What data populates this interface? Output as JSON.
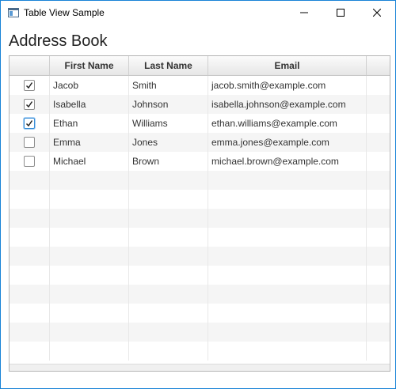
{
  "window": {
    "title": "Table View Sample",
    "icon": "app-window-icon",
    "controls": [
      "minimize-icon",
      "maximize-icon",
      "close-icon"
    ]
  },
  "heading": "Address Book",
  "table": {
    "columns": [
      "",
      "First Name",
      "Last Name",
      "Email"
    ],
    "rows": [
      {
        "checked": true,
        "focused": false,
        "first": "Jacob",
        "last": "Smith",
        "email": "jacob.smith@example.com"
      },
      {
        "checked": true,
        "focused": false,
        "first": "Isabella",
        "last": "Johnson",
        "email": "isabella.johnson@example.com"
      },
      {
        "checked": true,
        "focused": true,
        "first": "Ethan",
        "last": "Williams",
        "email": "ethan.williams@example.com"
      },
      {
        "checked": false,
        "focused": false,
        "first": "Emma",
        "last": "Jones",
        "email": "emma.jones@example.com"
      },
      {
        "checked": false,
        "focused": false,
        "first": "Michael",
        "last": "Brown",
        "email": "michael.brown@example.com"
      }
    ]
  },
  "colors": {
    "window_border": "#1883d7",
    "checkbox_focus": "#3a8fd7"
  }
}
